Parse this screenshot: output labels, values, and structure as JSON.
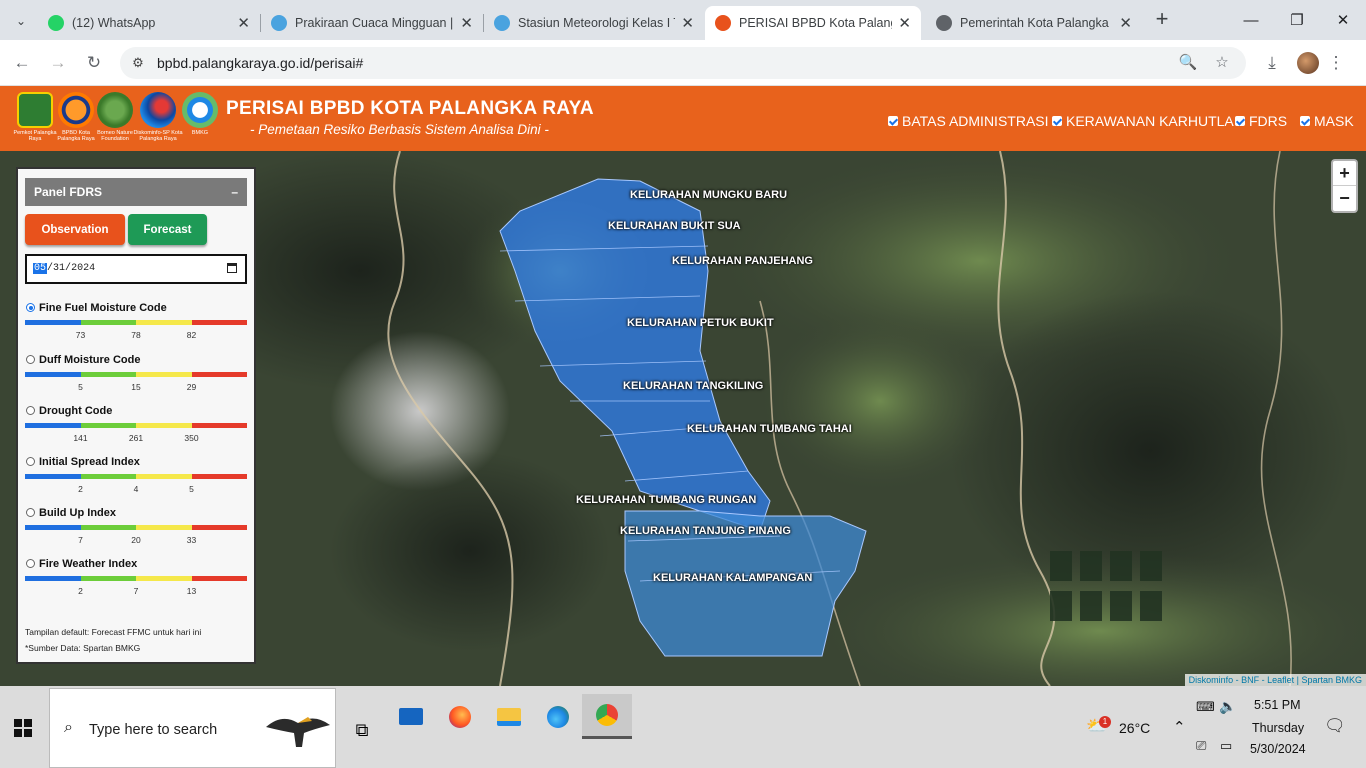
{
  "browser": {
    "tabs": [
      {
        "title": "(12) WhatsApp",
        "fav_color": "#25d366",
        "active": false
      },
      {
        "title": "Prakiraan Cuaca Mingguan |",
        "fav_color": "#4aa3df",
        "active": false
      },
      {
        "title": "Stasiun Meteorologi Kelas I T",
        "fav_color": "#4aa3df",
        "active": false
      },
      {
        "title": "PERISAI BPBD Kota Palangka",
        "fav_color": "#e8521c",
        "active": true
      },
      {
        "title": "Pemerintah Kota Palangka R",
        "fav_color": "#5f6368",
        "active": false
      }
    ],
    "url": "bpbd.palangkaraya.go.id/perisai#"
  },
  "header": {
    "title": "PERISAI BPBD KOTA PALANGKA RAYA",
    "subtitle": "- Pemetaan Resiko Berbasis Sistem Analisa Dini -",
    "logos": [
      {
        "caption": "Pemkot Palangka Raya",
        "color": "#2e7d32"
      },
      {
        "caption": "BPBD Kota Palangka Raya",
        "color": "#ff7a00"
      },
      {
        "caption": "Borneo Nature Foundation",
        "color": "#3b7a2a"
      },
      {
        "caption": "Diskominfo-SP Kota Palangka Raya",
        "color": "#0d47a1"
      },
      {
        "caption": "BMKG",
        "color": "#1e88e5"
      }
    ],
    "layers": [
      {
        "label": "BATAS ADMINISTRASI",
        "checked": true
      },
      {
        "label": "KERAWANAN KARHUTLA",
        "checked": true
      },
      {
        "label": "FDRS",
        "checked": true
      },
      {
        "label": "MASK",
        "checked": true
      }
    ]
  },
  "map": {
    "kelurahan": [
      "KELURAHAN MUNGKU BARU",
      "KELURAHAN BUKIT SUA",
      "KELURAHAN PANJEHANG",
      "KELURAHAN PETUK BUKIT",
      "KELURAHAN TANGKILING",
      "KELURAHAN TUMBANG TAHAI",
      "KELURAHAN TUMBANG RUNGAN",
      "KELURAHAN TANJUNG PINANG",
      "KELURAHAN KALAMPANGAN"
    ],
    "zoom_in": "+",
    "zoom_out": "−",
    "attribution": "Diskominfo - BNF - Leaflet | Spartan BMKG",
    "polygon_color": "#2f7ff0"
  },
  "panel": {
    "title": "Panel FDRS",
    "minimize": "–",
    "observation_label": "Observation",
    "forecast_label": "Forecast",
    "date": {
      "mm": "05",
      "dd": "31",
      "yyyy": "2024"
    },
    "scale_colors": [
      "#1f6fe0",
      "#6ccd3a",
      "#f5e84a",
      "#e53a2a"
    ],
    "indices": [
      {
        "name": "Fine Fuel Moisture Code",
        "selected": true,
        "ticks": [
          "73",
          "78",
          "82"
        ]
      },
      {
        "name": "Duff Moisture Code",
        "selected": false,
        "ticks": [
          "5",
          "15",
          "29"
        ]
      },
      {
        "name": "Drought Code",
        "selected": false,
        "ticks": [
          "141",
          "261",
          "350"
        ]
      },
      {
        "name": "Initial Spread Index",
        "selected": false,
        "ticks": [
          "2",
          "4",
          "5"
        ]
      },
      {
        "name": "Build Up Index",
        "selected": false,
        "ticks": [
          "7",
          "20",
          "33"
        ]
      },
      {
        "name": "Fire Weather Index",
        "selected": false,
        "ticks": [
          "2",
          "7",
          "13"
        ]
      }
    ],
    "note_default": "Tampilan default: Forecast FFMC untuk hari ini",
    "note_source": "*Sumber Data: Spartan BMKG"
  },
  "taskbar": {
    "search_placeholder": "Type here to search",
    "weather": "26°C",
    "weather_badge": "1",
    "time": "5:51 PM",
    "day": "Thursday",
    "date": "5/30/2024"
  }
}
